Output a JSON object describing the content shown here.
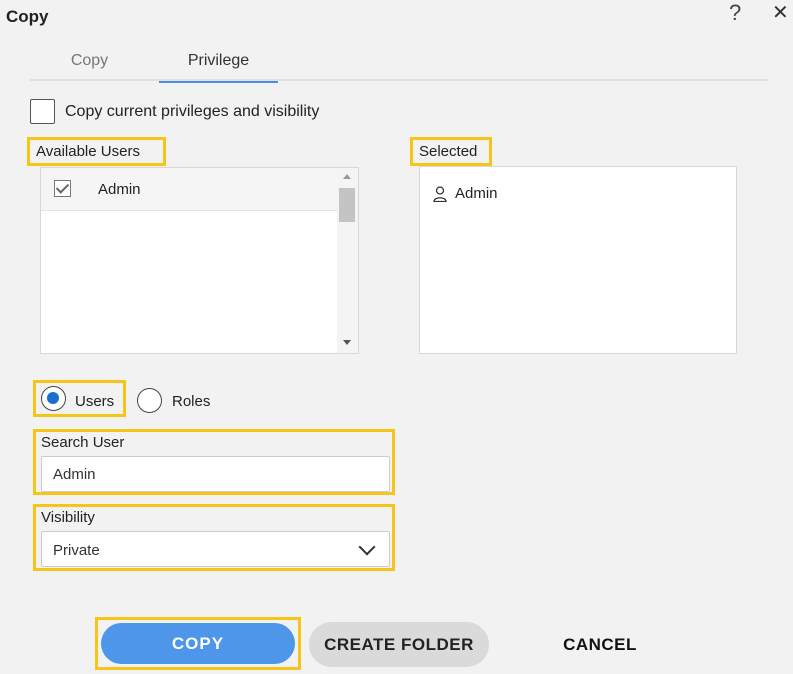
{
  "dialog": {
    "title": "Copy",
    "help_icon": "?",
    "close_icon": "✕"
  },
  "tabs": [
    {
      "label": "Copy",
      "active": false
    },
    {
      "label": "Privilege",
      "active": true
    }
  ],
  "copy_privileges": {
    "label": "Copy current privileges and visibility",
    "checked": false
  },
  "available_users": {
    "label": "Available Users",
    "items": [
      {
        "label": "Admin",
        "checked": true
      }
    ]
  },
  "selected": {
    "label": "Selected",
    "items": [
      {
        "label": "Admin",
        "icon": "person-icon"
      }
    ]
  },
  "mode": {
    "users_label": "Users",
    "roles_label": "Roles",
    "selected": "Users"
  },
  "search": {
    "label": "Search User",
    "value": "Admin"
  },
  "visibility": {
    "label": "Visibility",
    "value": "Private"
  },
  "buttons": {
    "copy": "COPY",
    "create_folder": "CREATE FOLDER",
    "cancel": "CANCEL"
  },
  "colors": {
    "highlight": "#f5c518",
    "primary": "#4e96ea",
    "tab_indicator": "#4a90e2"
  }
}
